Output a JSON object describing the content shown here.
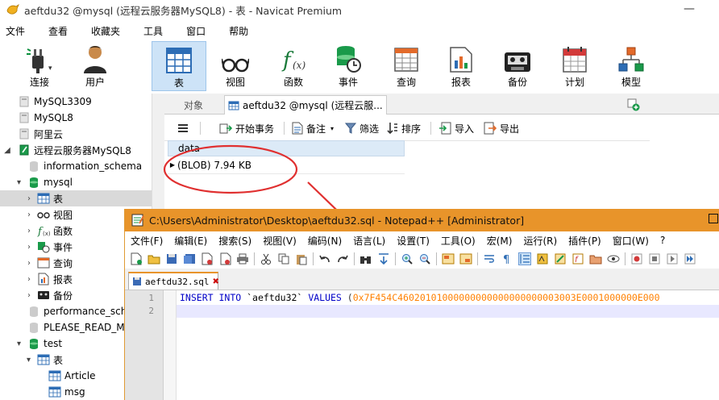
{
  "navicat": {
    "title": "aeftdu32 @mysql (远程云服务器MySQL8) - 表 - Navicat Premium",
    "menu": [
      "文件",
      "查看",
      "收藏夹",
      "工具",
      "窗口",
      "帮助"
    ],
    "toolbar": [
      {
        "label": "连接",
        "icon": "plug-icon"
      },
      {
        "label": "用户",
        "icon": "user-icon"
      },
      {
        "label": "表",
        "icon": "table-icon",
        "active": true
      },
      {
        "label": "视图",
        "icon": "glasses-icon"
      },
      {
        "label": "函数",
        "icon": "function-icon"
      },
      {
        "label": "事件",
        "icon": "event-clock-icon"
      },
      {
        "label": "查询",
        "icon": "query-icon"
      },
      {
        "label": "报表",
        "icon": "report-icon"
      },
      {
        "label": "备份",
        "icon": "backup-tape-icon"
      },
      {
        "label": "计划",
        "icon": "calendar-icon"
      },
      {
        "label": "模型",
        "icon": "model-icon"
      }
    ],
    "tree": {
      "items": [
        {
          "label": "MySQL3309"
        },
        {
          "label": "MySQL8"
        },
        {
          "label": "阿里云"
        },
        {
          "label": "远程云服务器MySQL8"
        },
        {
          "label": "information_schema"
        },
        {
          "label": "mysql"
        },
        {
          "label": "表"
        },
        {
          "label": "视图"
        },
        {
          "label": "函数"
        },
        {
          "label": "事件"
        },
        {
          "label": "查询"
        },
        {
          "label": "报表"
        },
        {
          "label": "备份"
        },
        {
          "label": "performance_schema"
        },
        {
          "label": "PLEASE_READ_ME"
        },
        {
          "label": "test"
        },
        {
          "label": "表"
        },
        {
          "label": "Article"
        },
        {
          "label": "msg"
        }
      ]
    },
    "tabs": {
      "objects": "对象",
      "query": "aeftdu32 @mysql (远程云服..."
    },
    "table_toolbar": {
      "begin": "开始事务",
      "note": "备注",
      "filter": "筛选",
      "sort": "排序",
      "import": "导入",
      "export": "导出"
    },
    "grid": {
      "column": "data",
      "cell": "(BLOB) 7.94 KB"
    },
    "annotation_color": "#e03030"
  },
  "notepad": {
    "title": "C:\\Users\\Administrator\\Desktop\\aeftdu32.sql - Notepad++ [Administrator]",
    "menu": [
      "文件(F)",
      "编辑(E)",
      "搜索(S)",
      "视图(V)",
      "编码(N)",
      "语言(L)",
      "设置(T)",
      "工具(O)",
      "宏(M)",
      "运行(R)",
      "插件(P)",
      "窗口(W)",
      "?"
    ],
    "tab": "aeftdu32.sql",
    "lines": [
      "1",
      "2"
    ],
    "code": {
      "kw1": "INSERT",
      "kw2": "INTO",
      "table": "`aeftdu32`",
      "kw3": "VALUES",
      "open": "(",
      "hex": "0x7F454C46020101000000000000000000003003E0001000000E000"
    },
    "accent": "#e8942a"
  }
}
